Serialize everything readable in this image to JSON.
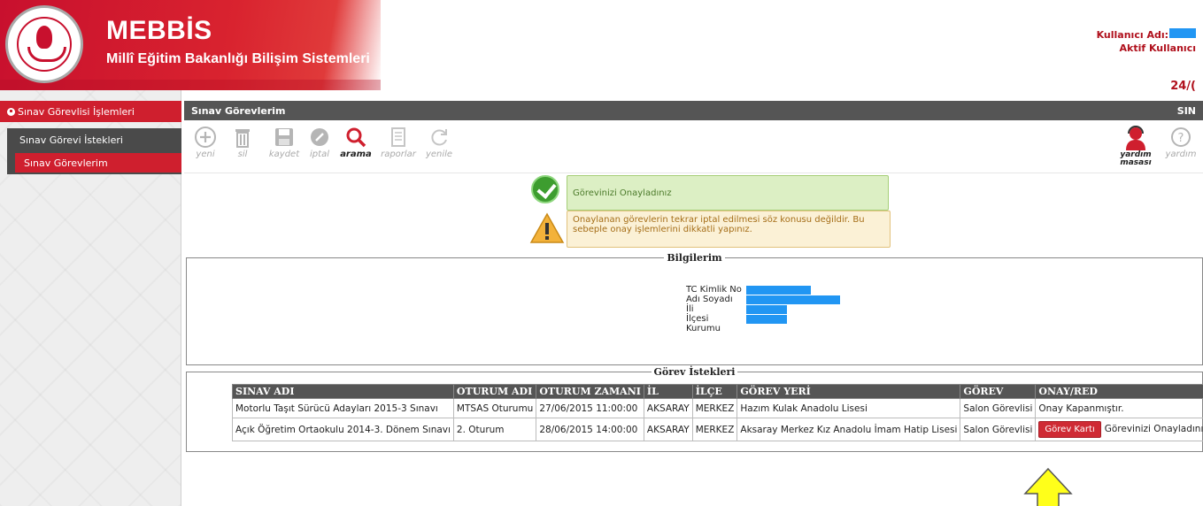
{
  "header": {
    "brand": "MEBBİS",
    "subtitle": "Millî Eğitim Bakanlığı Bilişim Sistemleri",
    "user_label": "Kullanıcı Adı:",
    "aktif_label": "Aktif Kullanıcı",
    "date_fragment": "24/(",
    "colors": {
      "red": "#c8102e",
      "user_redacted": "#2196f3"
    }
  },
  "sidebar": {
    "section_title": "Sınav Görevlisi İşlemleri",
    "items": [
      {
        "label": "Sınav Görevi İstekleri"
      },
      {
        "label": "Sınav Görevlerim",
        "active": true
      }
    ]
  },
  "page": {
    "title": "Sınav Görevlerim",
    "title_right": "SIN"
  },
  "toolbar": {
    "items": [
      {
        "label": "yeni",
        "icon": "plus-circle-icon"
      },
      {
        "label": "sil",
        "icon": "trash-icon"
      },
      {
        "label": "kaydet",
        "icon": "floppy-icon"
      },
      {
        "label": "iptal",
        "icon": "cancel-icon"
      },
      {
        "label": "arama",
        "icon": "search-icon",
        "active": true
      },
      {
        "label": "raporlar",
        "icon": "report-icon"
      },
      {
        "label": "yenile",
        "icon": "refresh-icon"
      }
    ],
    "right": [
      {
        "label": "yardım masası",
        "line1": "yardım",
        "line2": "masası",
        "icon": "helpdesk-icon"
      },
      {
        "label": "yardım",
        "icon": "help-icon"
      }
    ]
  },
  "messages": {
    "success": "Görevinizi Onayladınız",
    "warning": "Onaylanan görevlerin tekrar iptal edilmesi söz konusu değildir. Bu sebeple onay işlemlerini dikkatli yapınız."
  },
  "bilgilerim": {
    "legend": "Bilgilerim",
    "fields": [
      {
        "label": "TC Kimlik No"
      },
      {
        "label": "Adı Soyadı"
      },
      {
        "label": "İli"
      },
      {
        "label": "İlçesi"
      },
      {
        "label": "Kurumu"
      }
    ]
  },
  "gorev": {
    "legend": "Görev İstekleri",
    "columns": [
      "SINAV ADI",
      "OTURUM ADI",
      "OTURUM ZAMANI",
      "İL",
      "İLÇE",
      "GÖREV YERİ",
      "GÖREV",
      "ONAY/RED"
    ],
    "rows": [
      {
        "sinav": "Motorlu Taşıt Sürücü Adayları 2015-3 Sınavı",
        "oturum": "MTSAS Oturumu",
        "zaman": "27/06/2015 11:00:00",
        "il": "AKSARAY",
        "ilce": "MERKEZ",
        "yer": "Hazım Kulak Anadolu Lisesi",
        "gorev": "Salon Görevlisi",
        "onay": "Onay Kapanmıştır."
      },
      {
        "sinav": "Açık Öğretim Ortaokulu 2014-3. Dönem Sınavı",
        "oturum": "2. Oturum",
        "zaman": "28/06/2015 14:00:00",
        "il": "AKSARAY",
        "ilce": "MERKEZ",
        "yer": "Aksaray Merkez Kız Anadolu İmam Hatip Lisesi",
        "gorev": "Salon Görevlisi",
        "button": "Görev Kartı",
        "onay": "Görevinizi Onayladınız."
      }
    ]
  }
}
